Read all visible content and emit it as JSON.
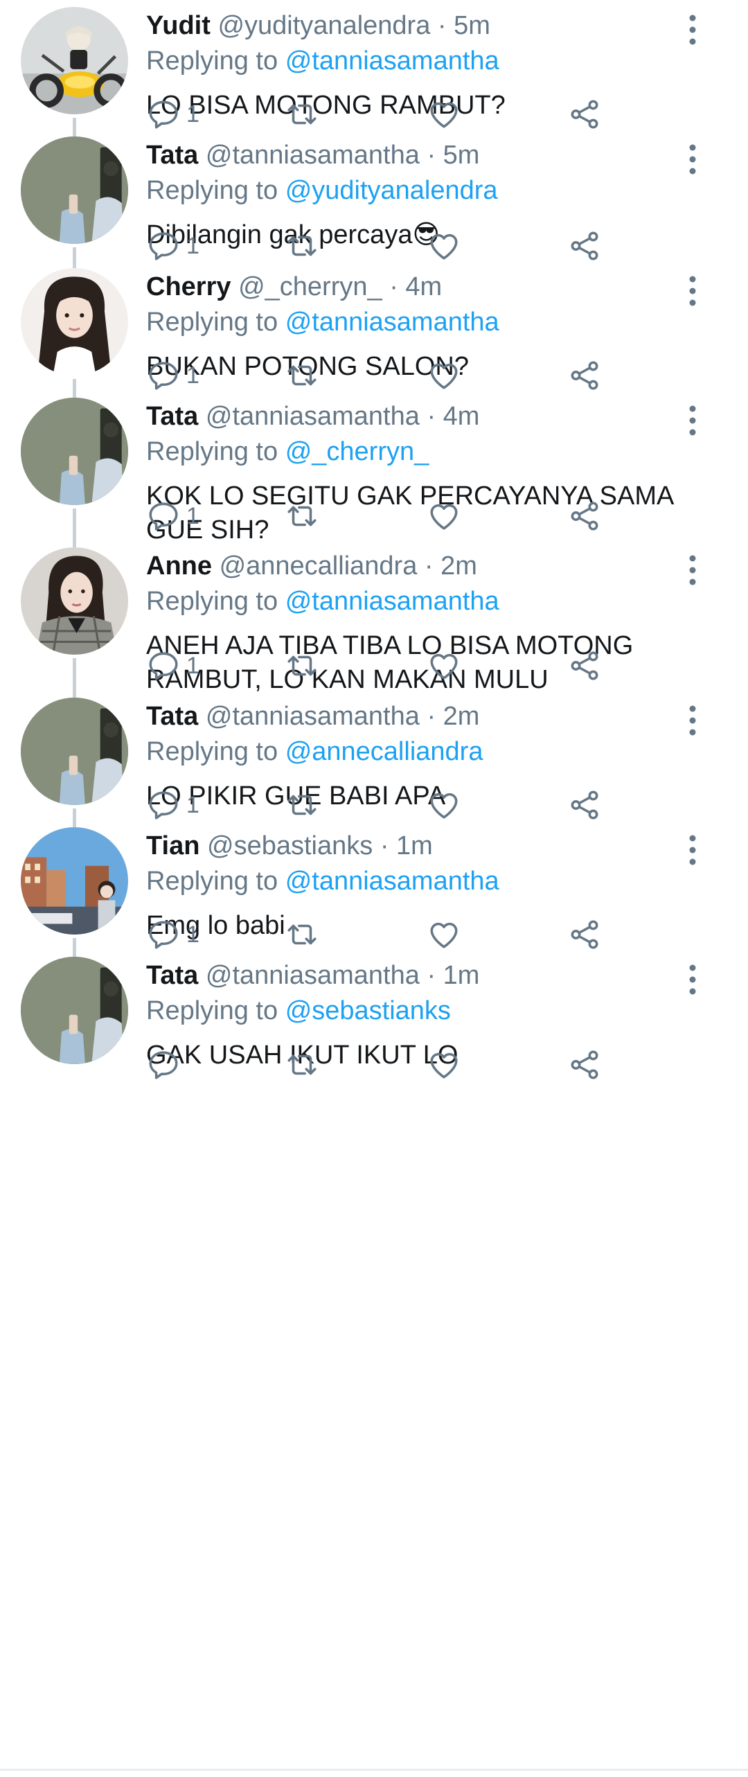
{
  "tweets": [
    {
      "name": "Yudit",
      "handle": "@yudityanalendra",
      "separator": "·",
      "time": "5m",
      "replying_prefix": "Replying to",
      "reply_to": "@tanniasamantha",
      "text": "LO BISA MOTONG RAMBUT?",
      "emoji": "",
      "reply_count": "1",
      "avatar": "avatar-person-on-motorcycle"
    },
    {
      "name": "Tata",
      "handle": "@tanniasamantha",
      "separator": "·",
      "time": "5m",
      "replying_prefix": "Replying to",
      "reply_to": "@yudityanalendra",
      "text": "Dibilangin gak percaya",
      "emoji": "😎",
      "reply_count": "1",
      "avatar": "avatar-mirror-selfie"
    },
    {
      "name": "Cherry",
      "handle": "@_cherryn_",
      "separator": "·",
      "time": "4m",
      "replying_prefix": "Replying to",
      "reply_to": "@tanniasamantha",
      "text": "BUKAN POTONG SALON?",
      "emoji": "",
      "reply_count": "1",
      "avatar": "avatar-girl-dark-hair"
    },
    {
      "name": "Tata",
      "handle": "@tanniasamantha",
      "separator": "·",
      "time": "4m",
      "replying_prefix": "Replying to",
      "reply_to": "@_cherryn_",
      "text": "KOK LO SEGITU GAK PERCAYANYA SAMA GUE SIH?",
      "emoji": "",
      "reply_count": "1",
      "avatar": "avatar-mirror-selfie"
    },
    {
      "name": "Anne",
      "handle": "@annecalliandra",
      "separator": "·",
      "time": "2m",
      "replying_prefix": "Replying to",
      "reply_to": "@tanniasamantha",
      "text": "ANEH AJA TIBA TIBA LO BISA MOTONG RAMBUT, LO KAN MAKAN MULU",
      "emoji": "",
      "reply_count": "1",
      "avatar": "avatar-girl-plaid-jacket"
    },
    {
      "name": "Tata",
      "handle": "@tanniasamantha",
      "separator": "·",
      "time": "2m",
      "replying_prefix": "Replying to",
      "reply_to": "@annecalliandra",
      "text": "LO PIKIR GUE BABI APA",
      "emoji": "",
      "reply_count": "1",
      "avatar": "avatar-mirror-selfie"
    },
    {
      "name": "Tian",
      "handle": "@sebastianks",
      "separator": "·",
      "time": "1m",
      "replying_prefix": "Replying to",
      "reply_to": "@tanniasamantha",
      "text": "Emg lo babi",
      "emoji": "",
      "reply_count": "1",
      "avatar": "avatar-city-street"
    },
    {
      "name": "Tata",
      "handle": "@tanniasamantha",
      "separator": "·",
      "time": "1m",
      "replying_prefix": "Replying to",
      "reply_to": "@sebastianks",
      "text": "GAK USAH IKUT IKUT LO",
      "emoji": "",
      "reply_count": "",
      "avatar": "avatar-mirror-selfie"
    }
  ],
  "colors": {
    "text_primary": "#14171a",
    "text_secondary": "#657786",
    "mention": "#1da1f2",
    "thread_line": "#c9d1d8",
    "icon": "#657786"
  },
  "icons": {
    "more": "more-vertical-icon",
    "reply": "reply-icon",
    "retweet": "retweet-icon",
    "like": "like-icon",
    "share": "share-icon"
  }
}
